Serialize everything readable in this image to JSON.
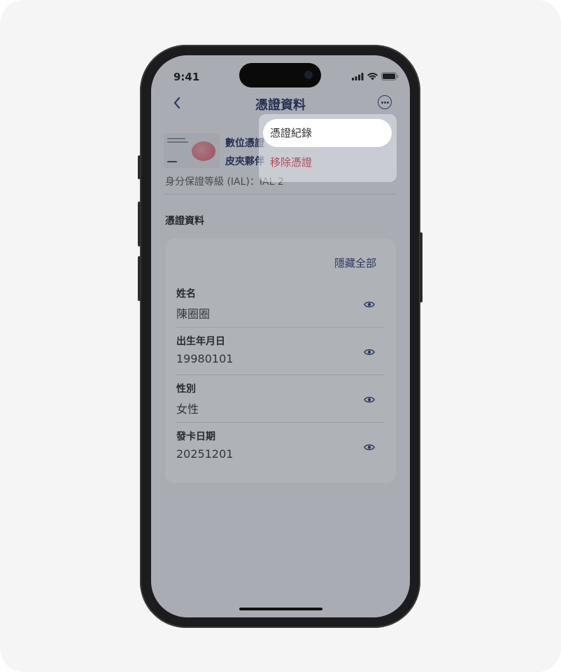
{
  "status_bar": {
    "time": "9:41"
  },
  "nav": {
    "title": "憑證資料"
  },
  "credential": {
    "name_line1": "數位憑證",
    "name_line2": "皮夾夥伴",
    "ial": "身分保證等級 (IAL)：IAL 2"
  },
  "section": {
    "title": "憑證資料"
  },
  "panel": {
    "hide_all_label": "隱藏全部",
    "fields": [
      {
        "label": "姓名",
        "value": "陳圈圈"
      },
      {
        "label": "出生年月日",
        "value": "19980101"
      },
      {
        "label": "性別",
        "value": "女性"
      },
      {
        "label": "發卡日期",
        "value": "20251201"
      }
    ]
  },
  "menu": {
    "items": [
      {
        "label": "憑證紀錄"
      },
      {
        "label": "移除憑證"
      }
    ]
  },
  "colors": {
    "accent": "#2b3a75",
    "danger": "#b24b5c"
  },
  "icons": {
    "back": "chevron-left-icon",
    "more": "more-circle-icon",
    "eye": "eye-icon"
  }
}
